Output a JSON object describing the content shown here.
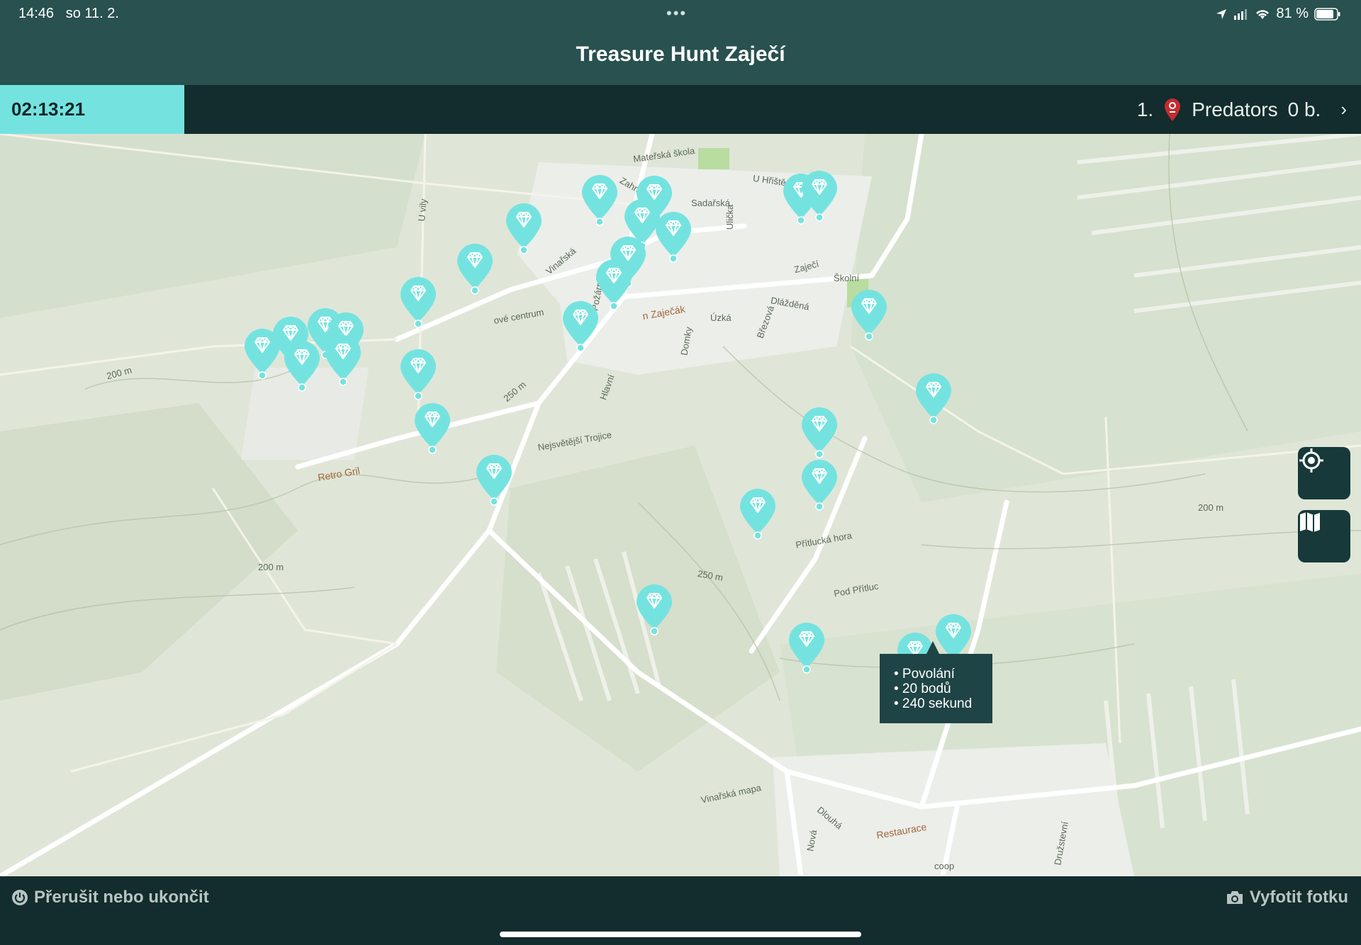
{
  "status_bar": {
    "time": "14:46",
    "date": "so 11. 2.",
    "battery": "81 %"
  },
  "header": {
    "title": "Treasure Hunt Zaječí"
  },
  "game": {
    "timer": "02:13:21",
    "rank": "1.",
    "team": "Predators",
    "score": "0 b."
  },
  "map": {
    "tooltip": {
      "line1": "• Povolání",
      "line2": "• 20 bodů",
      "line3": "• 240 sekund"
    },
    "labels": {
      "materska_skola": "Mateřská škola",
      "u_hriste": "U Hřiště",
      "zahradni": "Zahradní",
      "sadarska": "Sadařská",
      "ulicka": "Ulička",
      "zajeci": "Zaječí",
      "skolni": "Školní",
      "vinarska": "Vinařská",
      "pozarni": "Požární",
      "zajecak": "n Zaječák",
      "uzka": "Úzká",
      "domky": "Domky",
      "brezova": "Březová",
      "dlazdena": "Dlážděná",
      "u_vily": "U vily",
      "ove_centrum": "ové centrum",
      "hlavni": "Hlavní",
      "nejsvetejsi": "Nejsvětější Trojice",
      "retro_gril": "Retro Gril",
      "pritlucka_hora": "Přítlucká hora",
      "pod_pritluc": "Pod Přítluc",
      "vinarska_mapa": "Vinařská mapa",
      "restaurace": "Restaurace",
      "coop": "coop",
      "dlouha": "Dlouhá",
      "nova": "Nová",
      "druzstevni": "Družstevní",
      "contour_200": "200 m",
      "contour_250": "250 m"
    }
  },
  "footer": {
    "exit_label": "Přerušit nebo ukončit",
    "photo_label": "Vyfotit fotku"
  },
  "colors": {
    "accent": "#74e3e0",
    "header_bg": "#28514f",
    "bar_bg": "#132c2d"
  }
}
